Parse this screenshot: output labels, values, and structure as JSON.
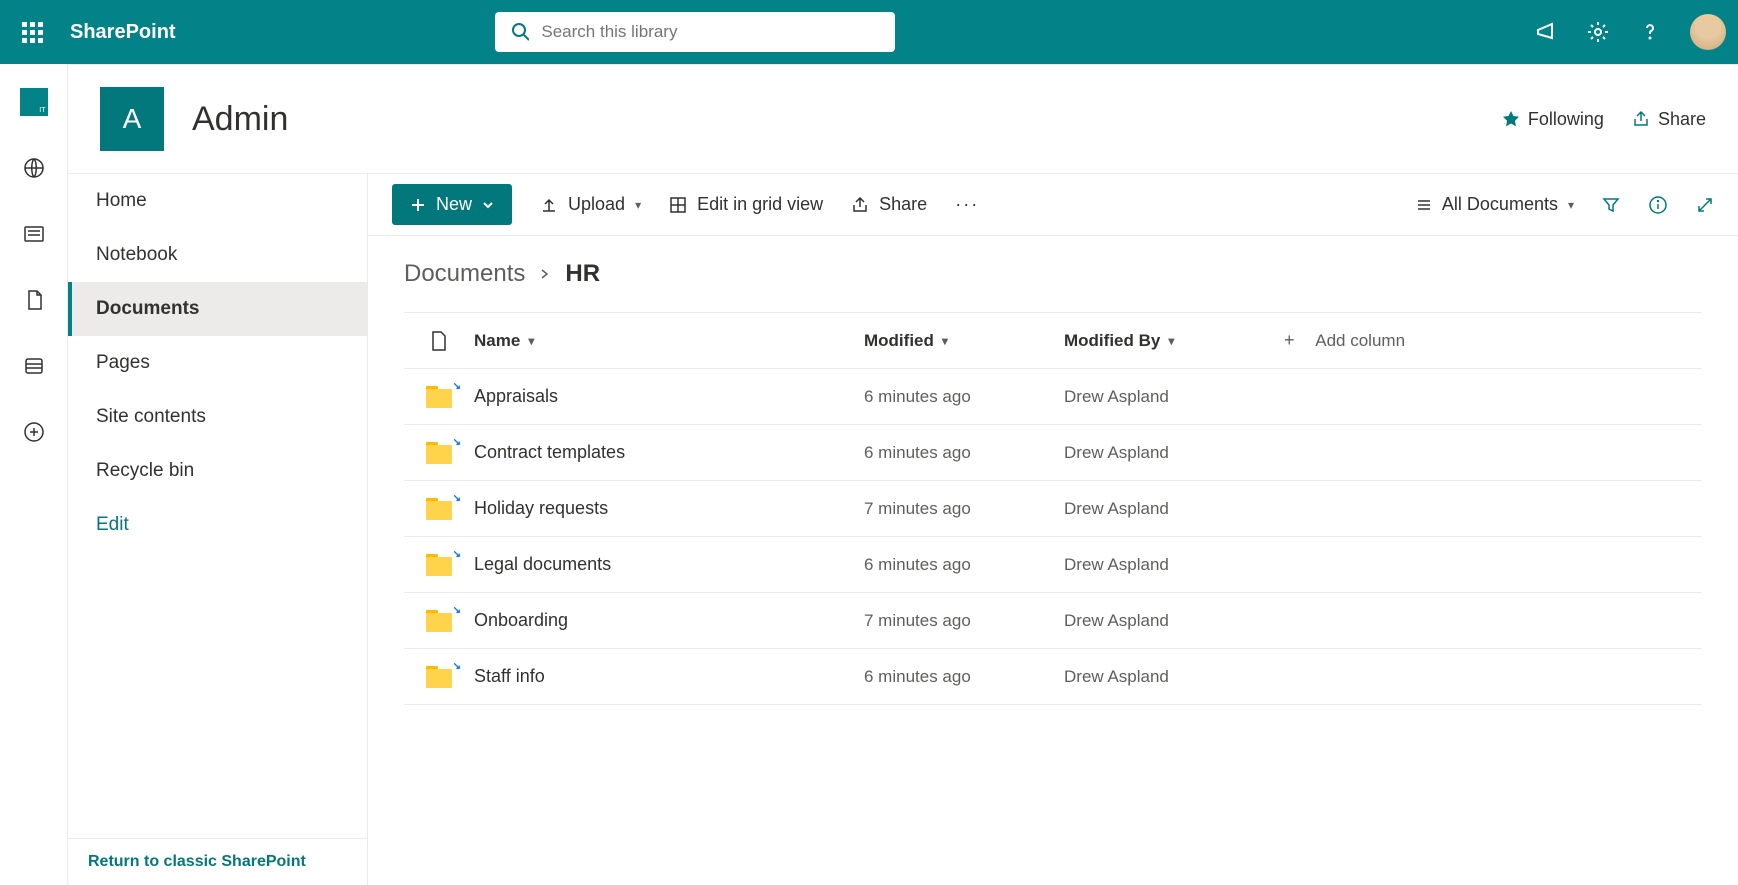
{
  "app": "SharePoint",
  "search_placeholder": "Search this library",
  "site": {
    "logo_letter": "A",
    "title": "Admin",
    "following": "Following",
    "share": "Share"
  },
  "leftnav": {
    "items": [
      {
        "label": "Home"
      },
      {
        "label": "Notebook"
      },
      {
        "label": "Documents",
        "active": true
      },
      {
        "label": "Pages"
      },
      {
        "label": "Site contents"
      },
      {
        "label": "Recycle bin"
      }
    ],
    "edit": "Edit",
    "return_classic": "Return to classic SharePoint"
  },
  "cmdbar": {
    "new": "New",
    "upload": "Upload",
    "edit_grid": "Edit in grid view",
    "share": "Share",
    "view": "All Documents"
  },
  "breadcrumb": {
    "root": "Documents",
    "current": "HR"
  },
  "columns": {
    "name": "Name",
    "modified": "Modified",
    "modified_by": "Modified By",
    "add": "Add column"
  },
  "rows": [
    {
      "name": "Appraisals",
      "modified": "6 minutes ago",
      "by": "Drew Aspland"
    },
    {
      "name": "Contract templates",
      "modified": "6 minutes ago",
      "by": "Drew Aspland"
    },
    {
      "name": "Holiday requests",
      "modified": "7 minutes ago",
      "by": "Drew Aspland"
    },
    {
      "name": "Legal documents",
      "modified": "6 minutes ago",
      "by": "Drew Aspland"
    },
    {
      "name": "Onboarding",
      "modified": "7 minutes ago",
      "by": "Drew Aspland"
    },
    {
      "name": "Staff info",
      "modified": "6 minutes ago",
      "by": "Drew Aspland"
    }
  ]
}
